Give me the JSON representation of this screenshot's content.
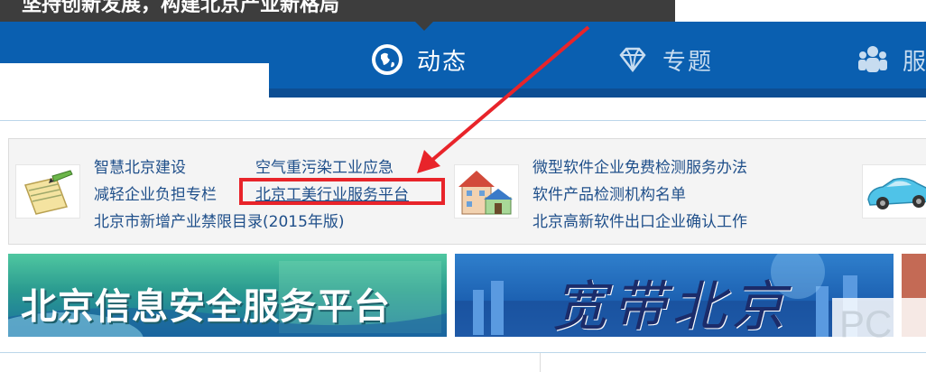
{
  "tooltip": {
    "text": "坚持创新发展，构建北京产业新格局"
  },
  "nav": {
    "items": [
      {
        "label": "动态",
        "icon": "globe-icon",
        "state": "active"
      },
      {
        "label": "专题",
        "icon": "diamond-icon",
        "state": "inactive"
      },
      {
        "label": "服",
        "icon": "people-icon",
        "state": "inactive"
      }
    ]
  },
  "links": {
    "col1": [
      "智慧北京建设",
      "减轻企业负担专栏",
      "北京市新增产业禁限目录(2015年版)"
    ],
    "col2": [
      "空气重污染工业应急",
      "北京工美行业服务平台"
    ],
    "col3": [
      "微型软件企业免费检测服务办法",
      "软件产品检测机构名单",
      "北京高新软件出口企业确认工作"
    ],
    "thumbs": [
      "notepad-pen-icon",
      "house-icon",
      "car-icon"
    ]
  },
  "annotation": {
    "color": "#e8242a"
  },
  "banners": {
    "b1": "北京信息安全服务平台",
    "b2": "宽带北京"
  },
  "watermark": {
    "text": "PC"
  },
  "colors": {
    "nav_blue": "#0a5fb0",
    "link_blue": "#1f4f8a",
    "highlight_red": "#e8242a"
  }
}
